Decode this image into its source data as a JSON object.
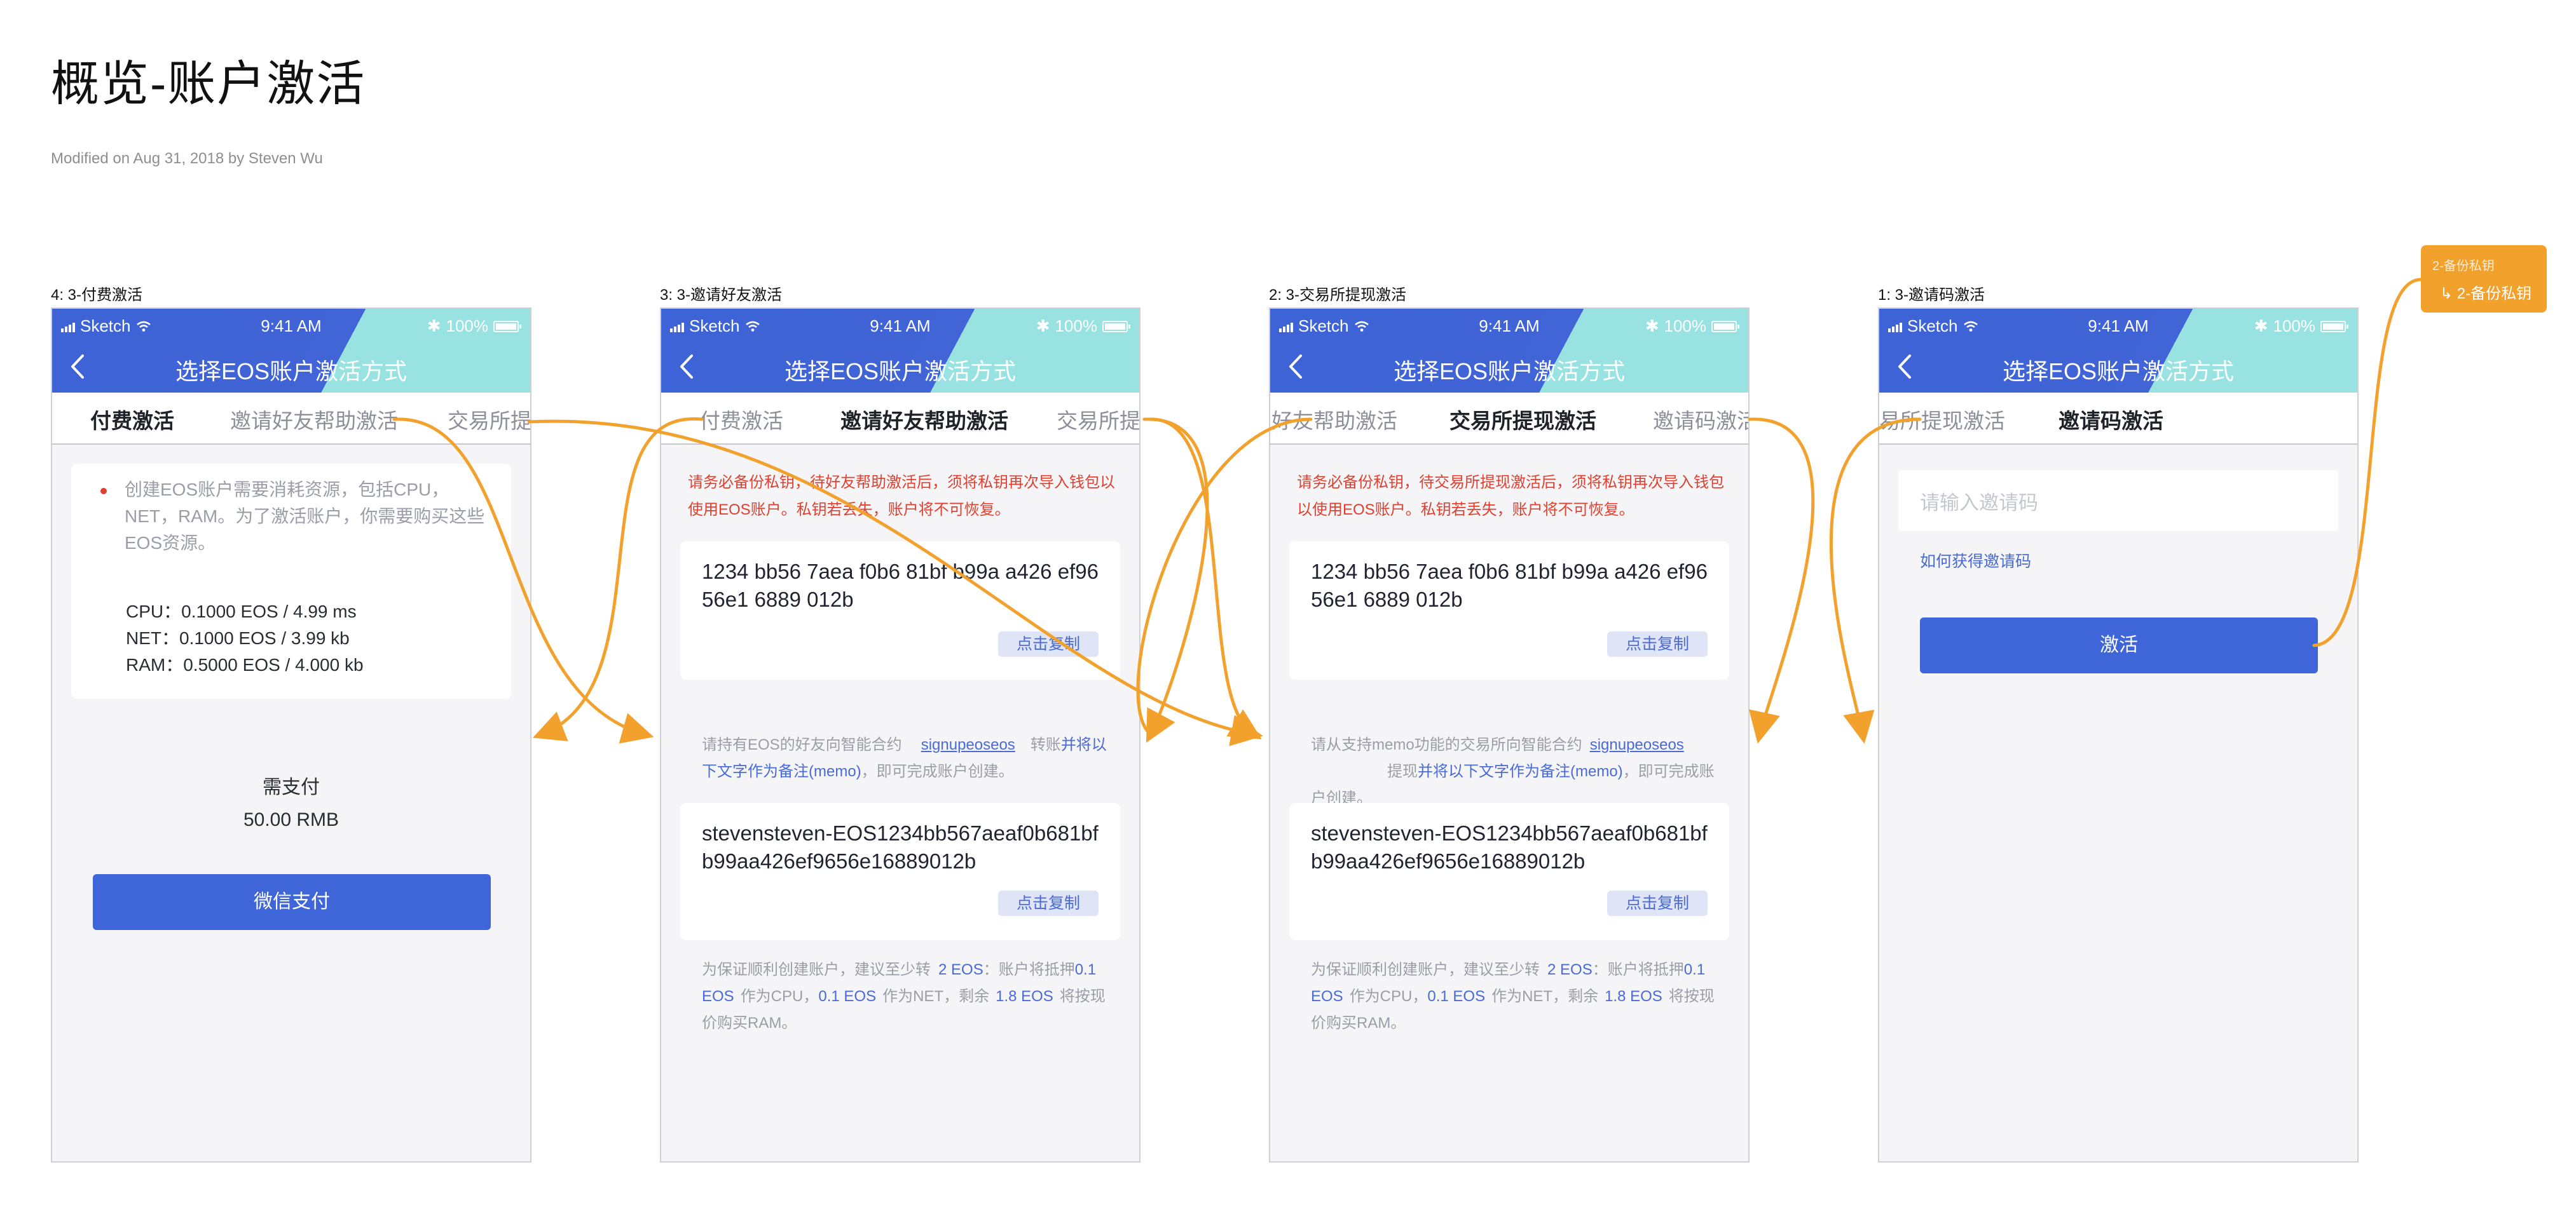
{
  "page": {
    "title": "概览-账户激活",
    "meta": "Modified on Aug 31, 2018 by Steven Wu"
  },
  "status_bar": {
    "carrier": "Sketch",
    "time": "9:41 AM",
    "battery": "100%"
  },
  "nav_title": "选择EOS账户激活方式",
  "artboards": {
    "a4": {
      "label": "4: 3-付费激活",
      "tabs": [
        "付费激活",
        "邀请好友帮助激活",
        "交易所提"
      ],
      "notice": "创建EOS账户需要消耗资源，包括CPU，NET，RAM。为了激活账户，你需要购买这些EOS资源。",
      "cpu": "CPU：0.1000 EOS / 4.99 ms",
      "net": "NET：0.1000 EOS / 3.99 kb",
      "ram": "RAM：0.5000 EOS / 4.000 kb",
      "pay_label": "需支付",
      "pay_amount": "50.00 RMB",
      "pay_button": "微信支付"
    },
    "a3": {
      "label": "3: 3-邀请好友激活",
      "tabs": [
        "付费激活",
        "邀请好友帮助激活",
        "交易所提"
      ],
      "warning": "请务必备份私钥，待好友帮助激活后，须将私钥再次导入钱包以使用EOS账户。私钥若丢失，账户将不可恢复。",
      "key": "1234 bb56 7aea f0b6 81bf b99a a426 ef96 56e1 6889 012b",
      "copy1": "点击复制",
      "instr_1": "请持有EOS的好友向智能合约",
      "instr_link": "signupeoseos",
      "instr_2": "转账",
      "instr_3": "并将以下文字作为备注(memo)",
      "instr_4": "，即可完成账户创建。",
      "memo": "stevensteven-EOS1234bb567aeaf0b681bfb99aa426ef9656e16889012b",
      "copy2": "点击复制",
      "tip_1": "为保证顺利创建账户，建议至少转",
      "tip_v1": "2 EOS",
      "tip_2": "：账户将抵押",
      "tip_v2": "0.1 EOS",
      "tip_3": "作为CPU，",
      "tip_v3": "0.1 EOS",
      "tip_4": "作为NET，剩余",
      "tip_v4": "1.8 EOS",
      "tip_5": "将按现价购买RAM。"
    },
    "a2": {
      "label": "2: 3-交易所提现激活",
      "tabs": [
        "好友帮助激活",
        "交易所提现激活",
        "邀请码激活"
      ],
      "warning": "请务必备份私钥，待交易所提现激活后，须将私钥再次导入钱包以使用EOS账户。私钥若丢失，账户将不可恢复。",
      "key": "1234 bb56 7aea f0b6 81bf b99a a426 ef96 56e1 6889 012b",
      "copy1": "点击复制",
      "instr_1": "请从支持memo功能的交易所向智能合约",
      "instr_link": "signupeoseos",
      "instr_2": "提现",
      "instr_3": "并将以下文字作为备注(memo)",
      "instr_4": "，即可完成账户创建。",
      "memo": "stevensteven-EOS1234bb567aeaf0b681bfb99aa426ef9656e16889012b",
      "copy2": "点击复制",
      "tip_1": "为保证顺利创建账户，建议至少转",
      "tip_v1": "2 EOS",
      "tip_2": "：账户将抵押",
      "tip_v2": "0.1 EOS",
      "tip_3": "作为CPU，",
      "tip_v3": "0.1 EOS",
      "tip_4": "作为NET，剩余",
      "tip_v4": "1.8 EOS",
      "tip_5": "将按现价购买RAM。"
    },
    "a1": {
      "label": "1: 3-邀请码激活",
      "tabs": [
        "易所提现激活",
        "邀请码激活"
      ],
      "input_placeholder": "请输入邀请码",
      "how_link": "如何获得邀请码",
      "activate_button": "激活"
    }
  },
  "flow_note": {
    "title": "2-备份私钥",
    "link": "↳ 2-备份私钥"
  },
  "colors": {
    "primary": "#3f66d9",
    "header_teal": "#98e2e2",
    "warning_red": "#e0402f",
    "flow_orange": "#f2a12c"
  }
}
